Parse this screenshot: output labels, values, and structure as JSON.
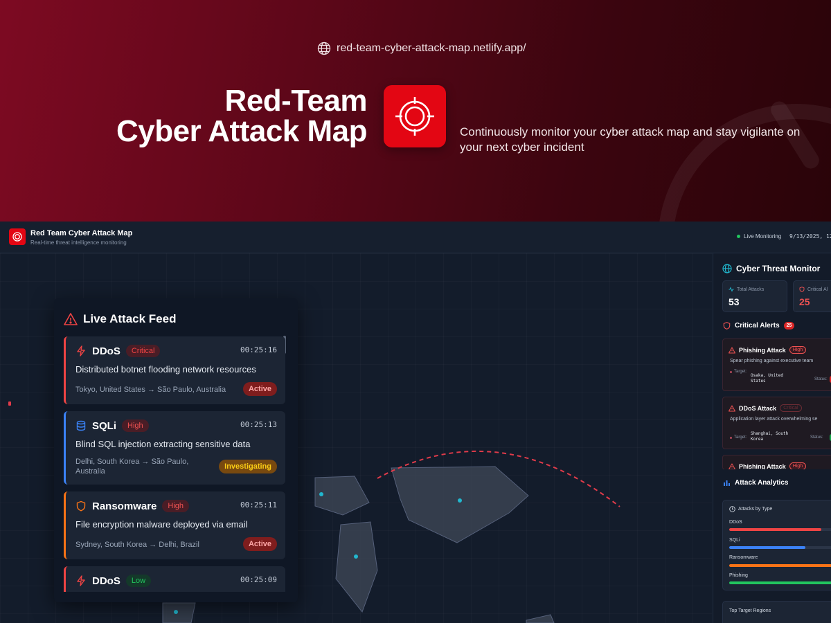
{
  "hero": {
    "url": "red-team-cyber-attack-map.netlify.app/",
    "title_line1": "Red-Team",
    "title_line2": "Cyber Attack Map",
    "tagline": "Continuously monitor your cyber attack map and stay vigilante on your next cyber incident"
  },
  "header": {
    "title": "Red Team Cyber Attack Map",
    "subtitle": "Real-time threat intelligence monitoring",
    "live_label": "Live Monitoring",
    "datetime": "9/13/2025, 12"
  },
  "feed": {
    "title": "Live Attack Feed",
    "items": [
      {
        "type": "DDoS",
        "severity": "Critical",
        "time": "00:25:16",
        "description": "Distributed botnet flooding network resources",
        "route": "Tokyo, United States → São Paulo, Australia",
        "status": "Active",
        "accent": "#ef4444",
        "icon": "lightning-icon"
      },
      {
        "type": "SQLi",
        "severity": "High",
        "time": "00:25:13",
        "description": "Blind SQL injection extracting sensitive data",
        "route": "Delhi, South Korea → São Paulo, Australia",
        "status": "Investigating",
        "accent": "#3b82f6",
        "icon": "database-icon"
      },
      {
        "type": "Ransomware",
        "severity": "High",
        "time": "00:25:11",
        "description": "File encryption malware deployed via email",
        "route": "Sydney, South Korea → Delhi, Brazil",
        "status": "Active",
        "accent": "#f97316",
        "icon": "shield-icon"
      },
      {
        "type": "DDoS",
        "severity": "Low",
        "time": "00:25:09",
        "description": "",
        "route": "",
        "status": "",
        "accent": "#ef4444",
        "icon": "lightning-icon"
      }
    ]
  },
  "monitor": {
    "title": "Cyber Threat Monitor",
    "total_label": "Total Attacks",
    "total_value": "53",
    "critical_label": "Critical Al",
    "critical_value": "25",
    "alerts_title": "Critical Alerts",
    "alerts_count": "25",
    "alerts": [
      {
        "title": "Phishing Attack",
        "severity": "High",
        "description": "Spear phishing against executive team",
        "target_label": "Target:",
        "target": "Osaka, United States",
        "status_label": "Status:",
        "status_color": "#dc2626"
      },
      {
        "title": "DDoS Attack",
        "severity": "Critical",
        "description": "Application layer attack overwhelming se",
        "target_label": "Target:",
        "target": "Shanghai, South Korea",
        "status_label": "Status:",
        "status_color": "#16a34a"
      },
      {
        "title": "Phishing Attack",
        "severity": "High",
        "description": "",
        "target_label": "",
        "target": "",
        "status_label": "",
        "status_color": "#dc2626"
      }
    ]
  },
  "analytics": {
    "title": "Attack Analytics",
    "by_type_title": "Attacks by Type",
    "types": [
      {
        "name": "DDoS",
        "share": 0.83,
        "color": "#ef4444"
      },
      {
        "name": "SQLi",
        "share": 0.69,
        "color": "#3b82f6"
      },
      {
        "name": "Ransomware",
        "share": 1.0,
        "color": "#f97316"
      },
      {
        "name": "Phishing",
        "share": 1.0,
        "color": "#22c55e"
      }
    ],
    "top_regions_title": "Top Target Regions"
  }
}
